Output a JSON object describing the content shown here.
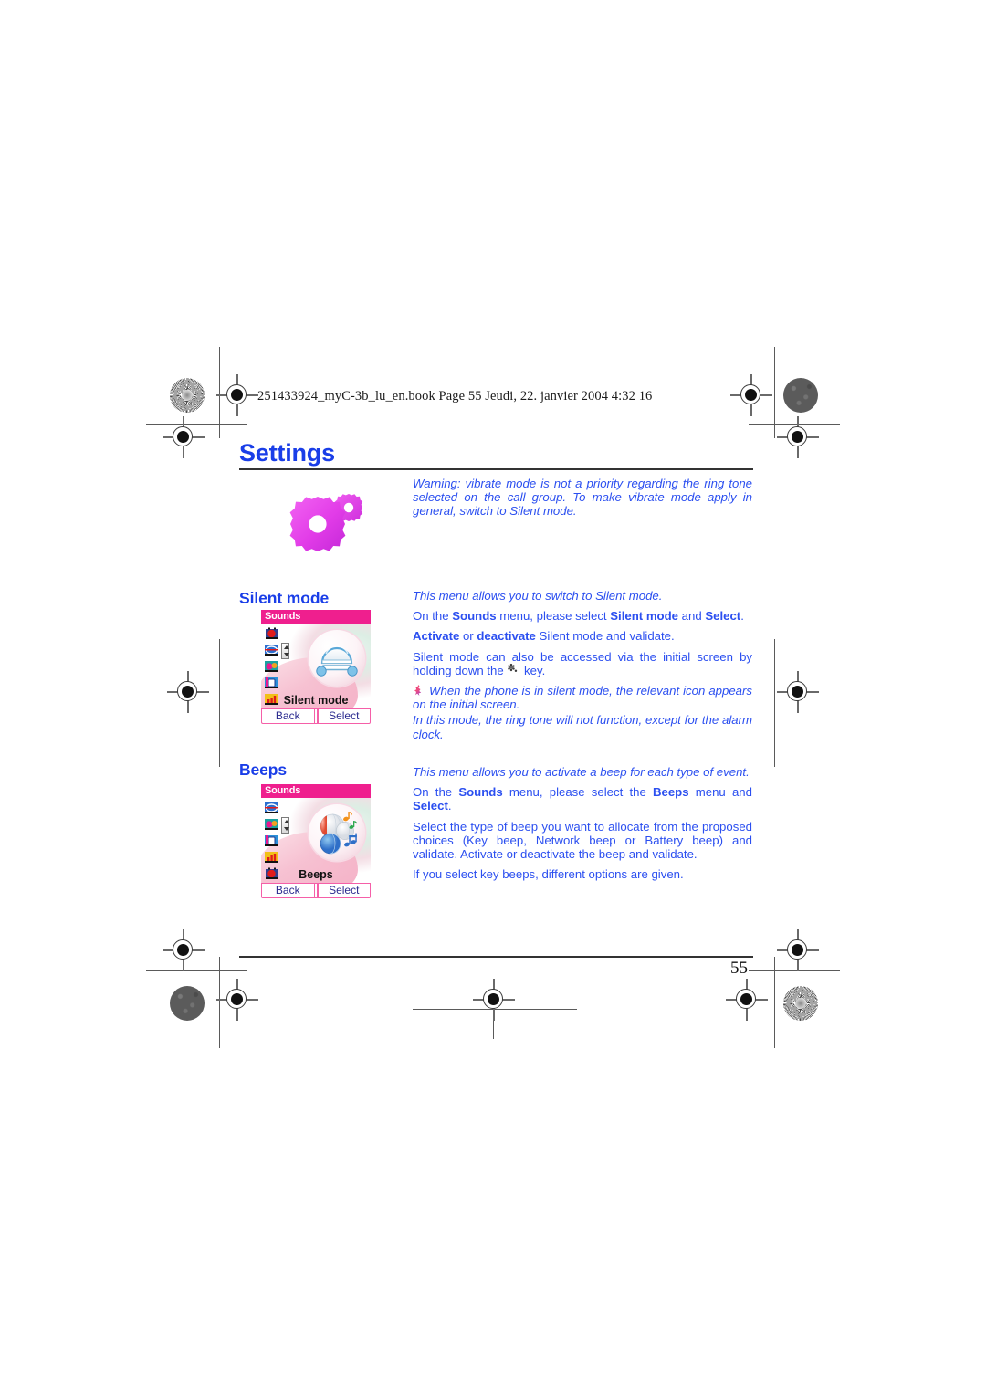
{
  "document": {
    "file_header": "251433924_myC-3b_lu_en.book  Page 55  Jeudi, 22. janvier 2004  4:32 16",
    "chapter_title": "Settings",
    "page_number": "55",
    "accent_blue": "#2b4ff0",
    "heading_blue": "#1a3ee8",
    "phone_magenta": "#ef1f8e",
    "gear_magenta": "#e040e0"
  },
  "warning": {
    "line1": "Warning: vibrate mode is not a priority regarding the ring tone selected",
    "line2": "on the call group. To make vibrate mode apply in general, switch to",
    "line3": "Silent mode.",
    "full": "Warning: vibrate mode is not a priority regarding the ring tone selected on the call group. To make vibrate mode apply in general, switch to Silent mode."
  },
  "sections": [
    {
      "heading": "Silent mode",
      "phone": {
        "title": "Sounds",
        "label": "Silent mode",
        "softkey_left": "Back",
        "softkey_right": "Select",
        "icons": [
          "alarm-clock-icon",
          "ring-tones-icon",
          "melody-icon",
          "vibrate-icon",
          "volume-icon"
        ],
        "illustration": "silent-mode-graphic"
      },
      "paragraphs": [
        {
          "style": "italic",
          "runs": [
            {
              "text": "This menu allows you to switch to Silent mode.",
              "bold": false
            }
          ]
        },
        {
          "style": "normal",
          "runs": [
            {
              "text": "On the ",
              "bold": false
            },
            {
              "text": "Sounds",
              "bold": true
            },
            {
              "text": " menu, please select ",
              "bold": false
            },
            {
              "text": "Silent mode",
              "bold": true
            },
            {
              "text": " and ",
              "bold": false
            },
            {
              "text": "Select",
              "bold": true
            },
            {
              "text": ".",
              "bold": false
            }
          ]
        },
        {
          "style": "normal",
          "runs": [
            {
              "text": "Activate",
              "bold": true
            },
            {
              "text": " or ",
              "bold": false
            },
            {
              "text": "deactivate",
              "bold": true
            },
            {
              "text": " Silent mode and validate.",
              "bold": false
            }
          ]
        },
        {
          "style": "normal-starkey",
          "runs": [
            {
              "text": "Silent mode can also be accessed via the initial screen by holding down the ",
              "bold": false
            },
            {
              "text": "STARKEY",
              "bold": false
            },
            {
              "text": " key.",
              "bold": false
            }
          ]
        },
        {
          "style": "italic-note",
          "runs": [
            {
              "text": "NOTEICON",
              "bold": false
            },
            {
              "text": " When the phone is in silent mode, the relevant icon appears on the initial screen.",
              "bold": false
            }
          ]
        },
        {
          "style": "italic",
          "runs": [
            {
              "text": "In this mode, the ring tone will not function, except for the alarm clock.",
              "bold": false
            }
          ]
        }
      ]
    },
    {
      "heading": "Beeps",
      "phone": {
        "title": "Sounds",
        "label": "Beeps",
        "softkey_left": "Back",
        "softkey_right": "Select",
        "icons": [
          "ring-tones-icon",
          "melody-icon",
          "vibrate-icon",
          "volume-icon",
          "alarm-clock-icon"
        ],
        "illustration": "beeps-graphic"
      },
      "paragraphs": [
        {
          "style": "italic",
          "runs": [
            {
              "text": "This menu allows you to activate a beep for each type of event.",
              "bold": false
            }
          ]
        },
        {
          "style": "normal",
          "runs": [
            {
              "text": "On the ",
              "bold": false
            },
            {
              "text": "Sounds",
              "bold": true
            },
            {
              "text": " menu, please select the ",
              "bold": false
            },
            {
              "text": "Beeps",
              "bold": true
            },
            {
              "text": " menu and ",
              "bold": false
            },
            {
              "text": "Select",
              "bold": true
            },
            {
              "text": ".",
              "bold": false
            }
          ]
        },
        {
          "style": "normal",
          "runs": [
            {
              "text": "Select the type of beep you want to allocate from the proposed choices (Key beep, Network beep or Battery beep) and validate. Activate or deactivate the beep and validate.",
              "bold": false
            }
          ]
        },
        {
          "style": "normal",
          "runs": [
            {
              "text": "If you select key beeps, different options are given.",
              "bold": false
            }
          ]
        }
      ]
    }
  ],
  "print_marks": {
    "registration_marks": 8,
    "screen_dots": [
      "halftone-burst-dot",
      "halftone-dark-dot",
      "halftone-dark-dot",
      "halftone-burst-dot"
    ]
  }
}
